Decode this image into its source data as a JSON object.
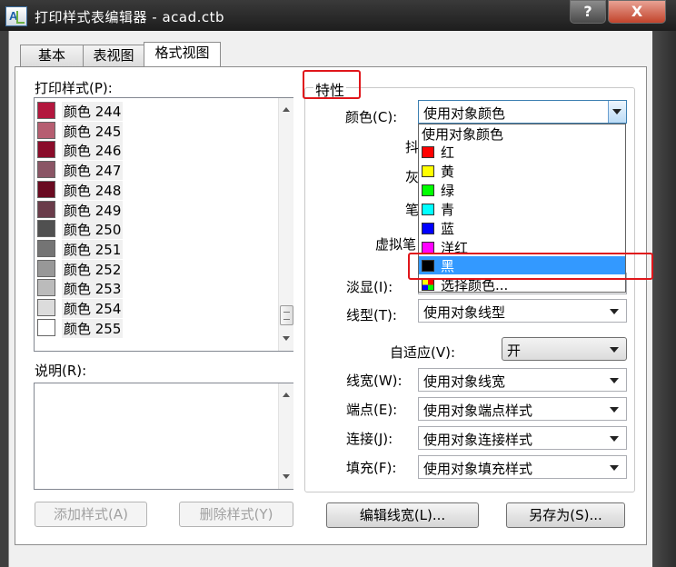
{
  "window": {
    "title": "打印样式表编辑器 - acad.ctb",
    "icon_text": "A",
    "help_label": "?",
    "close_label": "X"
  },
  "tabs": [
    {
      "label": "基本"
    },
    {
      "label": "表视图"
    },
    {
      "label": "格式视图",
      "active": true
    }
  ],
  "left": {
    "styles_label": "打印样式(P):",
    "styles": [
      {
        "name": "颜色  244",
        "color": "#b3173e"
      },
      {
        "name": "颜色  245",
        "color": "#b65e71"
      },
      {
        "name": "颜色  246",
        "color": "#8a0c2a"
      },
      {
        "name": "颜色  247",
        "color": "#8a5565"
      },
      {
        "name": "颜色  248",
        "color": "#6a0a21"
      },
      {
        "name": "颜色  249",
        "color": "#6a3c4a"
      },
      {
        "name": "颜色  250",
        "color": "#505050"
      },
      {
        "name": "颜色  251",
        "color": "#747474"
      },
      {
        "name": "颜色  252",
        "color": "#989898"
      },
      {
        "name": "颜色  253",
        "color": "#bbbbbb"
      },
      {
        "name": "颜色  254",
        "color": "#dcdcdc"
      },
      {
        "name": "颜色  255",
        "color": "#ffffff"
      }
    ],
    "description_label": "说明(R):",
    "add_style_button": "添加样式(A)",
    "delete_style_button": "删除样式(Y)"
  },
  "properties": {
    "group_title": "特性",
    "color_label": "颜色(C):",
    "color_value": "使用对象颜色",
    "hidden_labels": [
      "抖",
      "灰",
      "笔",
      "虚拟笔"
    ],
    "screening_label": "淡显(I):",
    "linetype_label": "线型(T):",
    "linetype_value": "使用对象线型",
    "adaptive_label": "自适应(V):",
    "adaptive_value": "开",
    "lineweight_label": "线宽(W):",
    "lineweight_value": "使用对象线宽",
    "endpoint_label": "端点(E):",
    "endpoint_value": "使用对象端点样式",
    "join_label": "连接(J):",
    "join_value": "使用对象连接样式",
    "fill_label": "填充(F):",
    "fill_value": "使用对象填充样式",
    "color_dropdown": [
      {
        "label": "使用对象颜色",
        "swatch": null
      },
      {
        "label": "红",
        "swatch": "#ff0000"
      },
      {
        "label": "黄",
        "swatch": "#ffff00"
      },
      {
        "label": "绿",
        "swatch": "#00ff00"
      },
      {
        "label": "青",
        "swatch": "#00ffff"
      },
      {
        "label": "蓝",
        "swatch": "#0000ff"
      },
      {
        "label": "洋红",
        "swatch": "#ff00ff"
      },
      {
        "label": "黑",
        "swatch": "#000000",
        "selected": true
      },
      {
        "label": "选择颜色...",
        "swatch": "multi"
      }
    ]
  },
  "buttons": {
    "edit_lineweights": "编辑线宽(L)...",
    "save_as": "另存为(S)..."
  }
}
